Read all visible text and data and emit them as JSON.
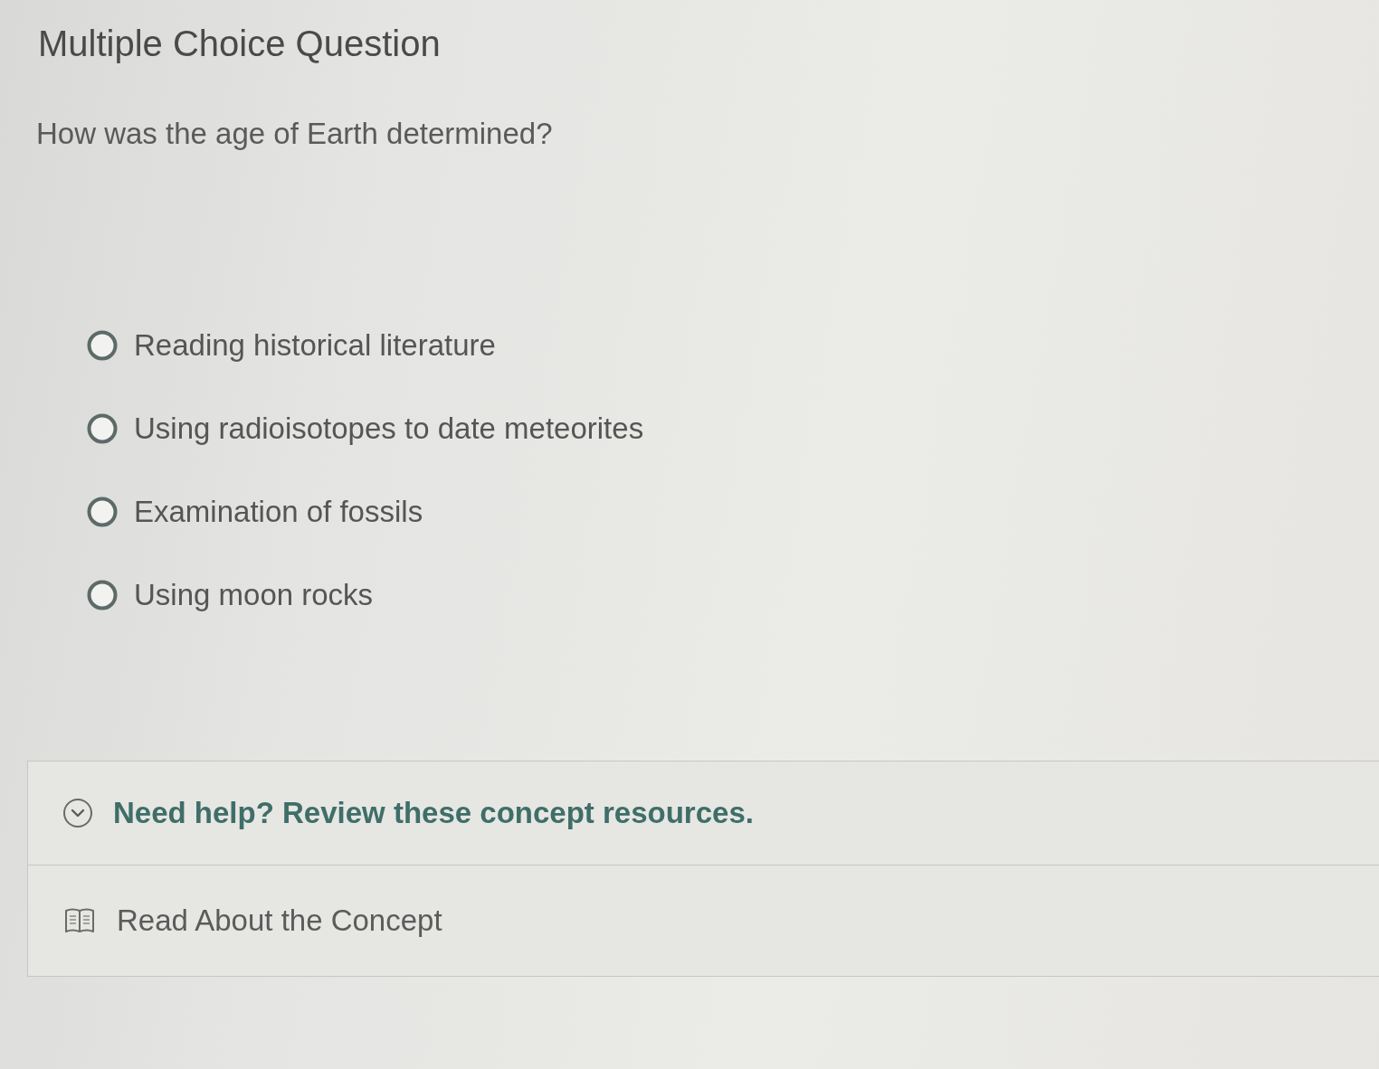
{
  "title": "Multiple Choice Question",
  "question": "How was the age of Earth determined?",
  "options": [
    {
      "label": "Reading historical literature",
      "selected": false
    },
    {
      "label": "Using radioisotopes to date meteorites",
      "selected": false
    },
    {
      "label": "Examination of fossils",
      "selected": false
    },
    {
      "label": "Using moon rocks",
      "selected": false
    }
  ],
  "help": {
    "heading": "Need help? Review these concept resources.",
    "expanded": true,
    "resources": [
      {
        "label": "Read About the Concept"
      }
    ]
  }
}
